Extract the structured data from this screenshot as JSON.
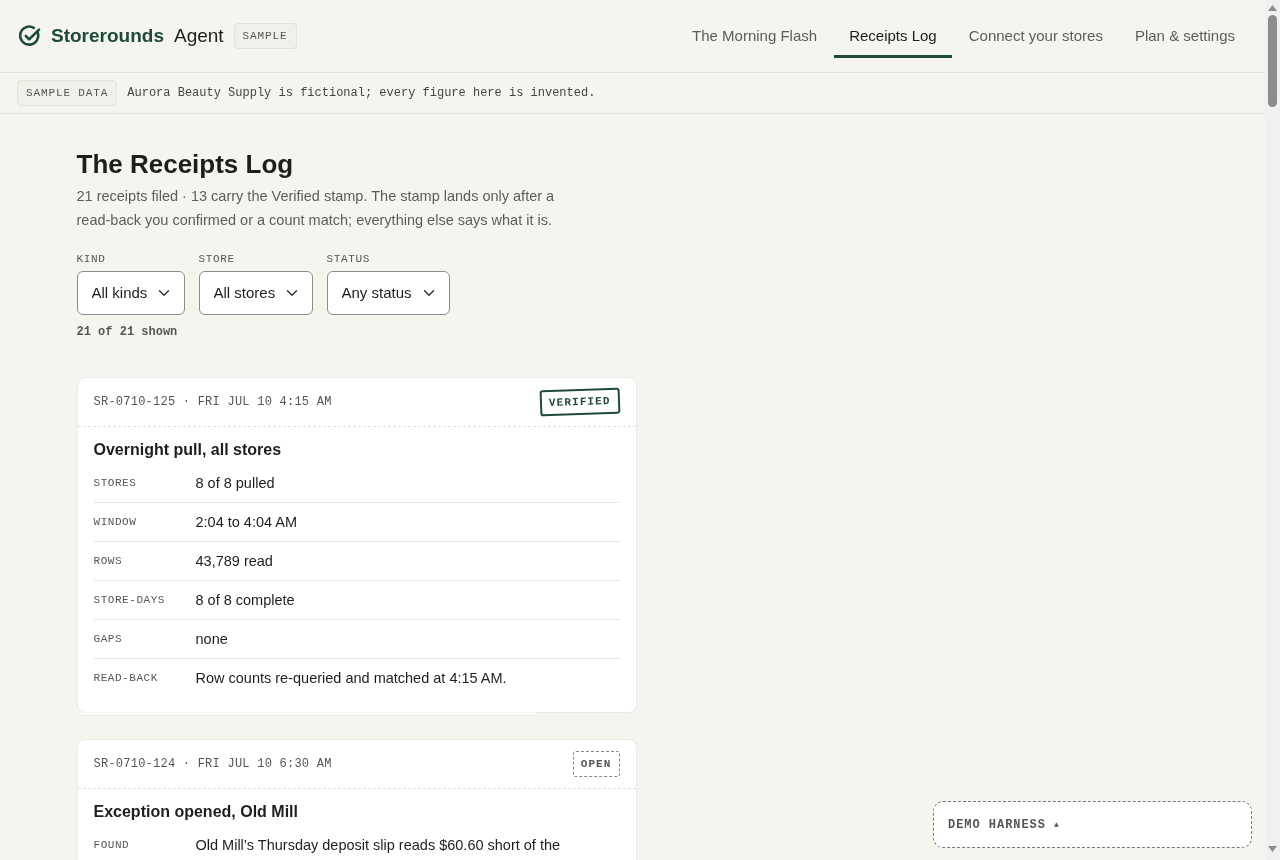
{
  "header": {
    "brand": {
      "name": "Storerounds",
      "product": "Agent",
      "badge": "SAMPLE"
    },
    "nav": [
      {
        "label": "The Morning Flash",
        "selected": false
      },
      {
        "label": "Receipts Log",
        "selected": true
      },
      {
        "label": "Connect your stores",
        "selected": false
      },
      {
        "label": "Plan & settings",
        "selected": false
      }
    ]
  },
  "notice": {
    "badge": "SAMPLE DATA",
    "text": "Aurora Beauty Supply is fictional; every figure here is invented."
  },
  "page": {
    "title": "The Receipts Log",
    "subtitle": "21 receipts filed · 13 carry the Verified stamp. The stamp lands only after a read-back you confirmed or a count match; everything else says what it is."
  },
  "filters": [
    {
      "label": "KIND",
      "value": "All kinds"
    },
    {
      "label": "STORE",
      "value": "All stores"
    },
    {
      "label": "STATUS",
      "value": "Any status"
    }
  ],
  "result_count": "21 of 21 shown",
  "receipts": [
    {
      "id_line": "SR-0710-125 · FRI JUL 10 4:15 AM",
      "stamp": {
        "kind": "verified",
        "text": "VERIFIED"
      },
      "title": "Overnight pull, all stores",
      "fields": [
        {
          "label": "STORES",
          "value": "8 of 8 pulled"
        },
        {
          "label": "WINDOW",
          "value": "2:04 to 4:04 AM"
        },
        {
          "label": "ROWS",
          "value": "43,789 read"
        },
        {
          "label": "STORE-DAYS",
          "value": "8 of 8 complete"
        },
        {
          "label": "GAPS",
          "value": "none"
        },
        {
          "label": "READ-BACK",
          "value": "Row counts re-queried and matched at 4:15 AM."
        }
      ],
      "torn_edge": true
    },
    {
      "id_line": "SR-0710-124 · FRI JUL 10 6:30 AM",
      "stamp": {
        "kind": "open",
        "text": "OPEN"
      },
      "title": "Exception opened, Old Mill",
      "fields": [
        {
          "label": "FOUND",
          "value": "Old Mill’s Thursday deposit slip reads $60.60 short of the"
        }
      ]
    }
  ],
  "demo_harness": {
    "label": "DEMO HARNESS",
    "toggle": "▲"
  }
}
